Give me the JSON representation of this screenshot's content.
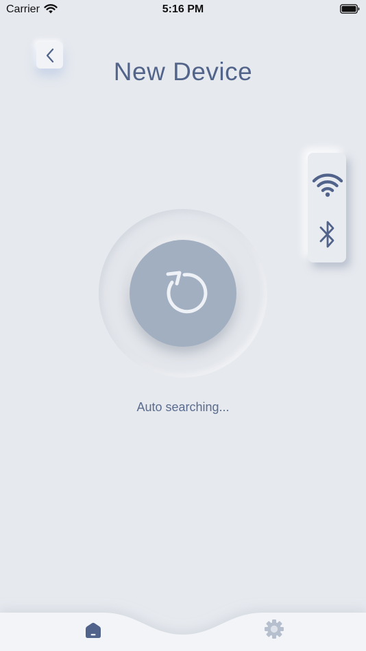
{
  "status_bar": {
    "carrier": "Carrier",
    "time": "5:16 PM",
    "icons": [
      "wifi-signal-icon",
      "battery-icon"
    ]
  },
  "header": {
    "title": "New Device",
    "back_icon": "chevron-left-icon"
  },
  "connection_modes": [
    {
      "icon": "wifi-icon"
    },
    {
      "icon": "bluetooth-icon"
    }
  ],
  "search": {
    "icon": "refresh-icon",
    "status": "Auto searching..."
  },
  "tab_bar": {
    "tabs": [
      {
        "icon": "home-icon",
        "active": true
      },
      {
        "icon": "gear-icon",
        "active": false
      }
    ]
  },
  "colors": {
    "background": "#e6e9ee",
    "accent": "#52648a",
    "search_button": "#a2afc1"
  }
}
